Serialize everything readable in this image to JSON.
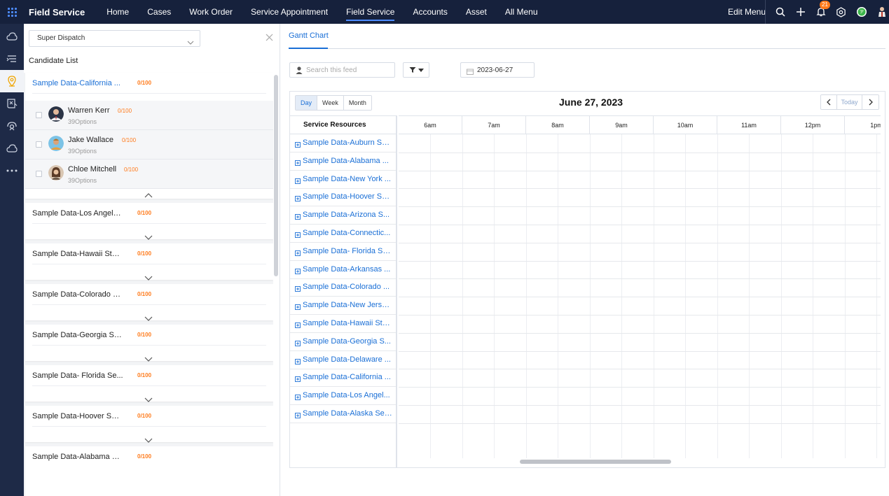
{
  "topbar": {
    "brand": "Field Service",
    "nav": [
      "Home",
      "Cases",
      "Work Order",
      "Service Appointment",
      "Field Service",
      "Accounts",
      "Asset",
      "All Menu"
    ],
    "active_nav": "Field Service",
    "edit_menu": "Edit Menu",
    "notification_count": "21",
    "icons": [
      "apps-grid-icon",
      "search-icon",
      "plus-icon",
      "bell-icon",
      "gear-icon",
      "globe-icon",
      "user-avatar"
    ]
  },
  "sidebar": {
    "icons": [
      "cloud-icon",
      "dispatch-lines-icon",
      "location-pin-icon",
      "map-book-icon",
      "satellite-icon",
      "cloud-icon",
      "more-icon"
    ],
    "active_index": 2
  },
  "left_panel": {
    "dispatch_select": "Super Dispatch",
    "candidate_title": "Candidate List",
    "groups": [
      {
        "name": "Sample Data-California ...",
        "score": "0/100"
      },
      {
        "name": "Sample Data-Los Angele...",
        "score": "0/100"
      },
      {
        "name": "Sample Data-Hawaii Stat...",
        "score": "0/100"
      },
      {
        "name": "Sample Data-Colorado S...",
        "score": "0/100"
      },
      {
        "name": "Sample Data-Georgia Se...",
        "score": "0/100"
      },
      {
        "name": "Sample Data- Florida Se...",
        "score": "0/100"
      },
      {
        "name": "Sample Data-Hoover Ser...",
        "score": "0/100"
      },
      {
        "name": "Sample Data-Alabama S...",
        "score": "0/100"
      }
    ],
    "candidates": [
      {
        "name": "Warren Kerr",
        "score": "0/100",
        "options": "39Options"
      },
      {
        "name": "Jake Wallace",
        "score": "0/100",
        "options": "39Options"
      },
      {
        "name": "Chloe Mitchell",
        "score": "0/100",
        "options": "39Options"
      }
    ]
  },
  "right_panel": {
    "tab": "Gantt Chart",
    "search_placeholder": "Search this feed",
    "date_value": "2023-06-27",
    "view_buttons": [
      "Day",
      "Week",
      "Month"
    ],
    "active_view": "Day",
    "gantt_date": "June 27, 2023",
    "today_label": "Today",
    "resources_header": "Service Resources",
    "hours": [
      "6am",
      "7am",
      "8am",
      "9am",
      "10am",
      "11am",
      "12pm",
      "1pm"
    ],
    "resources": [
      "Sample Data-Auburn Se...",
      "Sample Data-Alabama ...",
      "Sample Data-New York ...",
      "Sample Data-Hoover Se...",
      "Sample Data-Arizona S...",
      "Sample Data-Connectic...",
      "Sample Data- Florida Se...",
      "Sample Data-Arkansas ...",
      "Sample Data-Colorado ...",
      "Sample Data-New Jerse...",
      "Sample Data-Hawaii Sta...",
      "Sample Data-Georgia S...",
      "Sample Data-Delaware ...",
      "Sample Data-California ...",
      "Sample Data-Los Angel...",
      "Sample Data-Alaska Ser..."
    ]
  },
  "colors": {
    "topbar": "#16213c",
    "sidebar": "#1e2a47",
    "accent": "#1a6fd6",
    "score": "#ff7a1a"
  }
}
